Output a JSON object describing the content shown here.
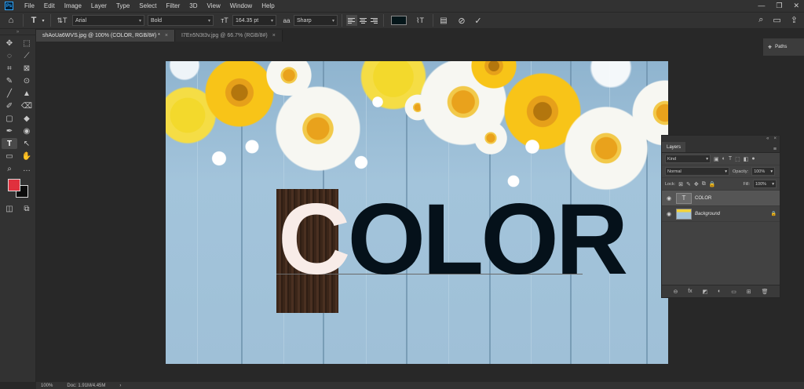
{
  "app": {
    "logo": "Ps"
  },
  "menu": [
    "File",
    "Edit",
    "Image",
    "Layer",
    "Type",
    "Select",
    "Filter",
    "3D",
    "View",
    "Window",
    "Help"
  ],
  "window_controls": {
    "minimize": "—",
    "restore": "❐",
    "close": "✕"
  },
  "options": {
    "tool_icon": "T",
    "orientation_icon": "⇅T",
    "font_family": "Arial",
    "font_style": "Bold",
    "size_icon": "тT",
    "font_size": "164.35 pt",
    "aa_icon": "aa",
    "antialias": "Sharp",
    "text_color": "#05161a",
    "warp_icon": "⌇T",
    "panel_icon": "▤",
    "cancel_icon": "⊘",
    "commit_icon": "✓",
    "search_icon": "⌕",
    "workspace_icon": "▭",
    "share_icon": "⇪"
  },
  "tabs": [
    {
      "label": "shAoUa6WVS.jpg @ 100% (COLOR, RGB/8#) *",
      "close": "×"
    },
    {
      "label": "I7En5N3t3v.jpg @ 66.7% (RGB/8#)",
      "close": "×"
    }
  ],
  "tools": [
    "✥",
    "⬚",
    "◌",
    "⟋",
    "⌗",
    "⊠",
    "✎",
    "⊙",
    "╱",
    "▲",
    "✐",
    "⌫",
    "▢",
    "◆",
    "✒",
    "◉",
    "T",
    "↖",
    "▭",
    "✋",
    "⌕",
    "…",
    "◫",
    "⧉"
  ],
  "colors": {
    "foreground": "#e0303d",
    "background": "#0c0c0c"
  },
  "canvas": {
    "text": "COLOR",
    "first_letter": "C",
    "rest": "OLOR"
  },
  "paths_panel": {
    "label": "Paths",
    "icon": "⌖"
  },
  "layers_panel": {
    "tab": "Layers",
    "menu_icon": "≡",
    "collapse_icon": "«",
    "close_icon": "×",
    "kind_label": "Kind",
    "blend_mode": "Normal",
    "opacity_label": "Opacity:",
    "opacity_value": "100%",
    "lock_label": "Lock:",
    "fill_label": "Fill:",
    "fill_value": "100%",
    "layers": [
      {
        "name": "COLOR",
        "thumb": "T",
        "selected": true
      },
      {
        "name": "Background",
        "thumb": "",
        "selected": false,
        "locked": true
      }
    ],
    "bottom_icons": [
      "⊖",
      "fx",
      "◩",
      "◐",
      "▭",
      "⊞",
      "🗑"
    ]
  },
  "status": {
    "zoom": "100%",
    "doc": "Doc: 1.91M/4.45M",
    "arrow": "›"
  }
}
